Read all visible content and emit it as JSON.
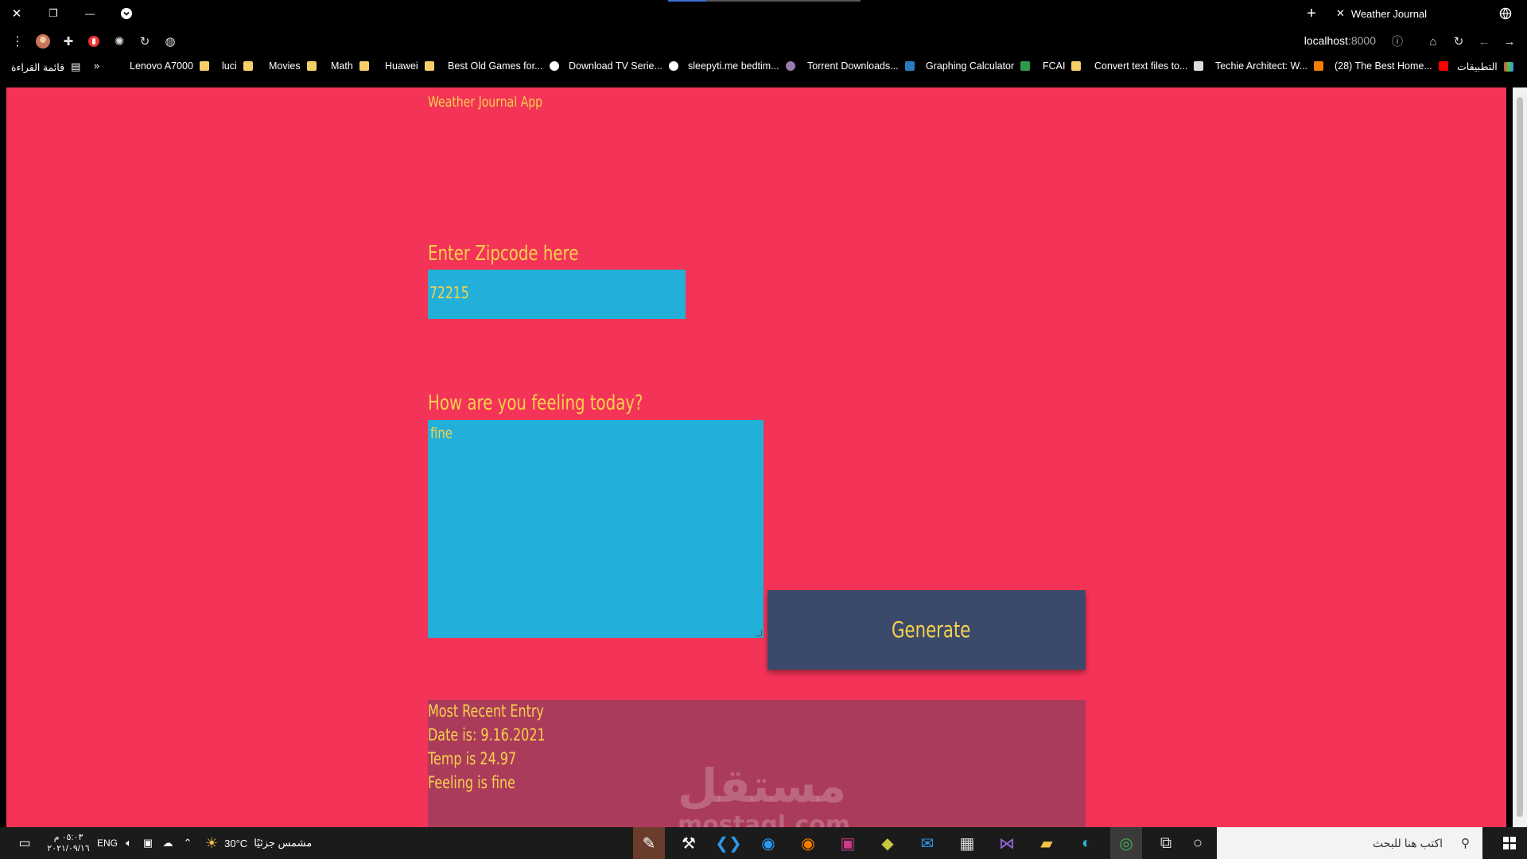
{
  "browser": {
    "tab": {
      "title": "Weather Journal",
      "close": "✕"
    },
    "window_controls": {
      "close": "✕",
      "restore": "❐",
      "minimize": "—"
    },
    "new_tab": "+",
    "url": {
      "host": "localhost",
      "port": ":8000"
    },
    "bookmarks": [
      {
        "label": "قائمة القراءة",
        "icon": "reading-list-icon"
      },
      {
        "label": "»",
        "icon": "more-bookmarks-icon"
      },
      {
        "label": "Lenovo A7000",
        "icon": "folder-icon"
      },
      {
        "label": "luci",
        "icon": "folder-icon"
      },
      {
        "label": "Movies",
        "icon": "folder-icon"
      },
      {
        "label": "Math",
        "icon": "folder-icon"
      },
      {
        "label": "Huawei",
        "icon": "folder-icon"
      },
      {
        "label": "Best Old Games for...",
        "icon": "globe-icon"
      },
      {
        "label": "Download TV Serie...",
        "icon": "globe-icon"
      },
      {
        "label": "sleepyti.me bedtim...",
        "icon": "moon-icon"
      },
      {
        "label": "Torrent Downloads...",
        "icon": "td-icon"
      },
      {
        "label": "Graphing Calculator",
        "icon": "desmos-icon"
      },
      {
        "label": "FCAI",
        "icon": "folder-icon"
      },
      {
        "label": "Convert text files to...",
        "icon": "st-icon"
      },
      {
        "label": "Techie Architect: W...",
        "icon": "blogger-icon"
      },
      {
        "label": "(28) The Best Home...",
        "icon": "youtube-icon"
      },
      {
        "label": "التطبيقات",
        "icon": "apps-grid-icon"
      }
    ]
  },
  "app": {
    "title": "Weather Journal App",
    "zip": {
      "label": "Enter Zipcode here",
      "value": "72215"
    },
    "feelings": {
      "label": "How are you feeling today?",
      "value": "fine"
    },
    "generate_label": "Generate",
    "entry": {
      "heading": "Most Recent Entry",
      "date": "Date is: 9.16.2021",
      "temp": "Temp is 24.97",
      "feeling": "Feeling is fine"
    },
    "watermark": {
      "arabic": "مستقل",
      "latin": "mostaql.com"
    }
  },
  "taskbar": {
    "time": "٠٥:٠٣ م",
    "date": "٢٠٢١/٠٩/١٦",
    "language": "ENG",
    "weather": {
      "temp": "30°C",
      "desc": "مشمس جزئيًا"
    },
    "search_placeholder": "اكتب هنا للبحث"
  },
  "colors": {
    "page_bg": "#f33357",
    "text": "#f6d14c",
    "input_bg": "#22b0d8",
    "button_bg": "#3b4a6b",
    "entry_bg": "#ab3b5b"
  }
}
